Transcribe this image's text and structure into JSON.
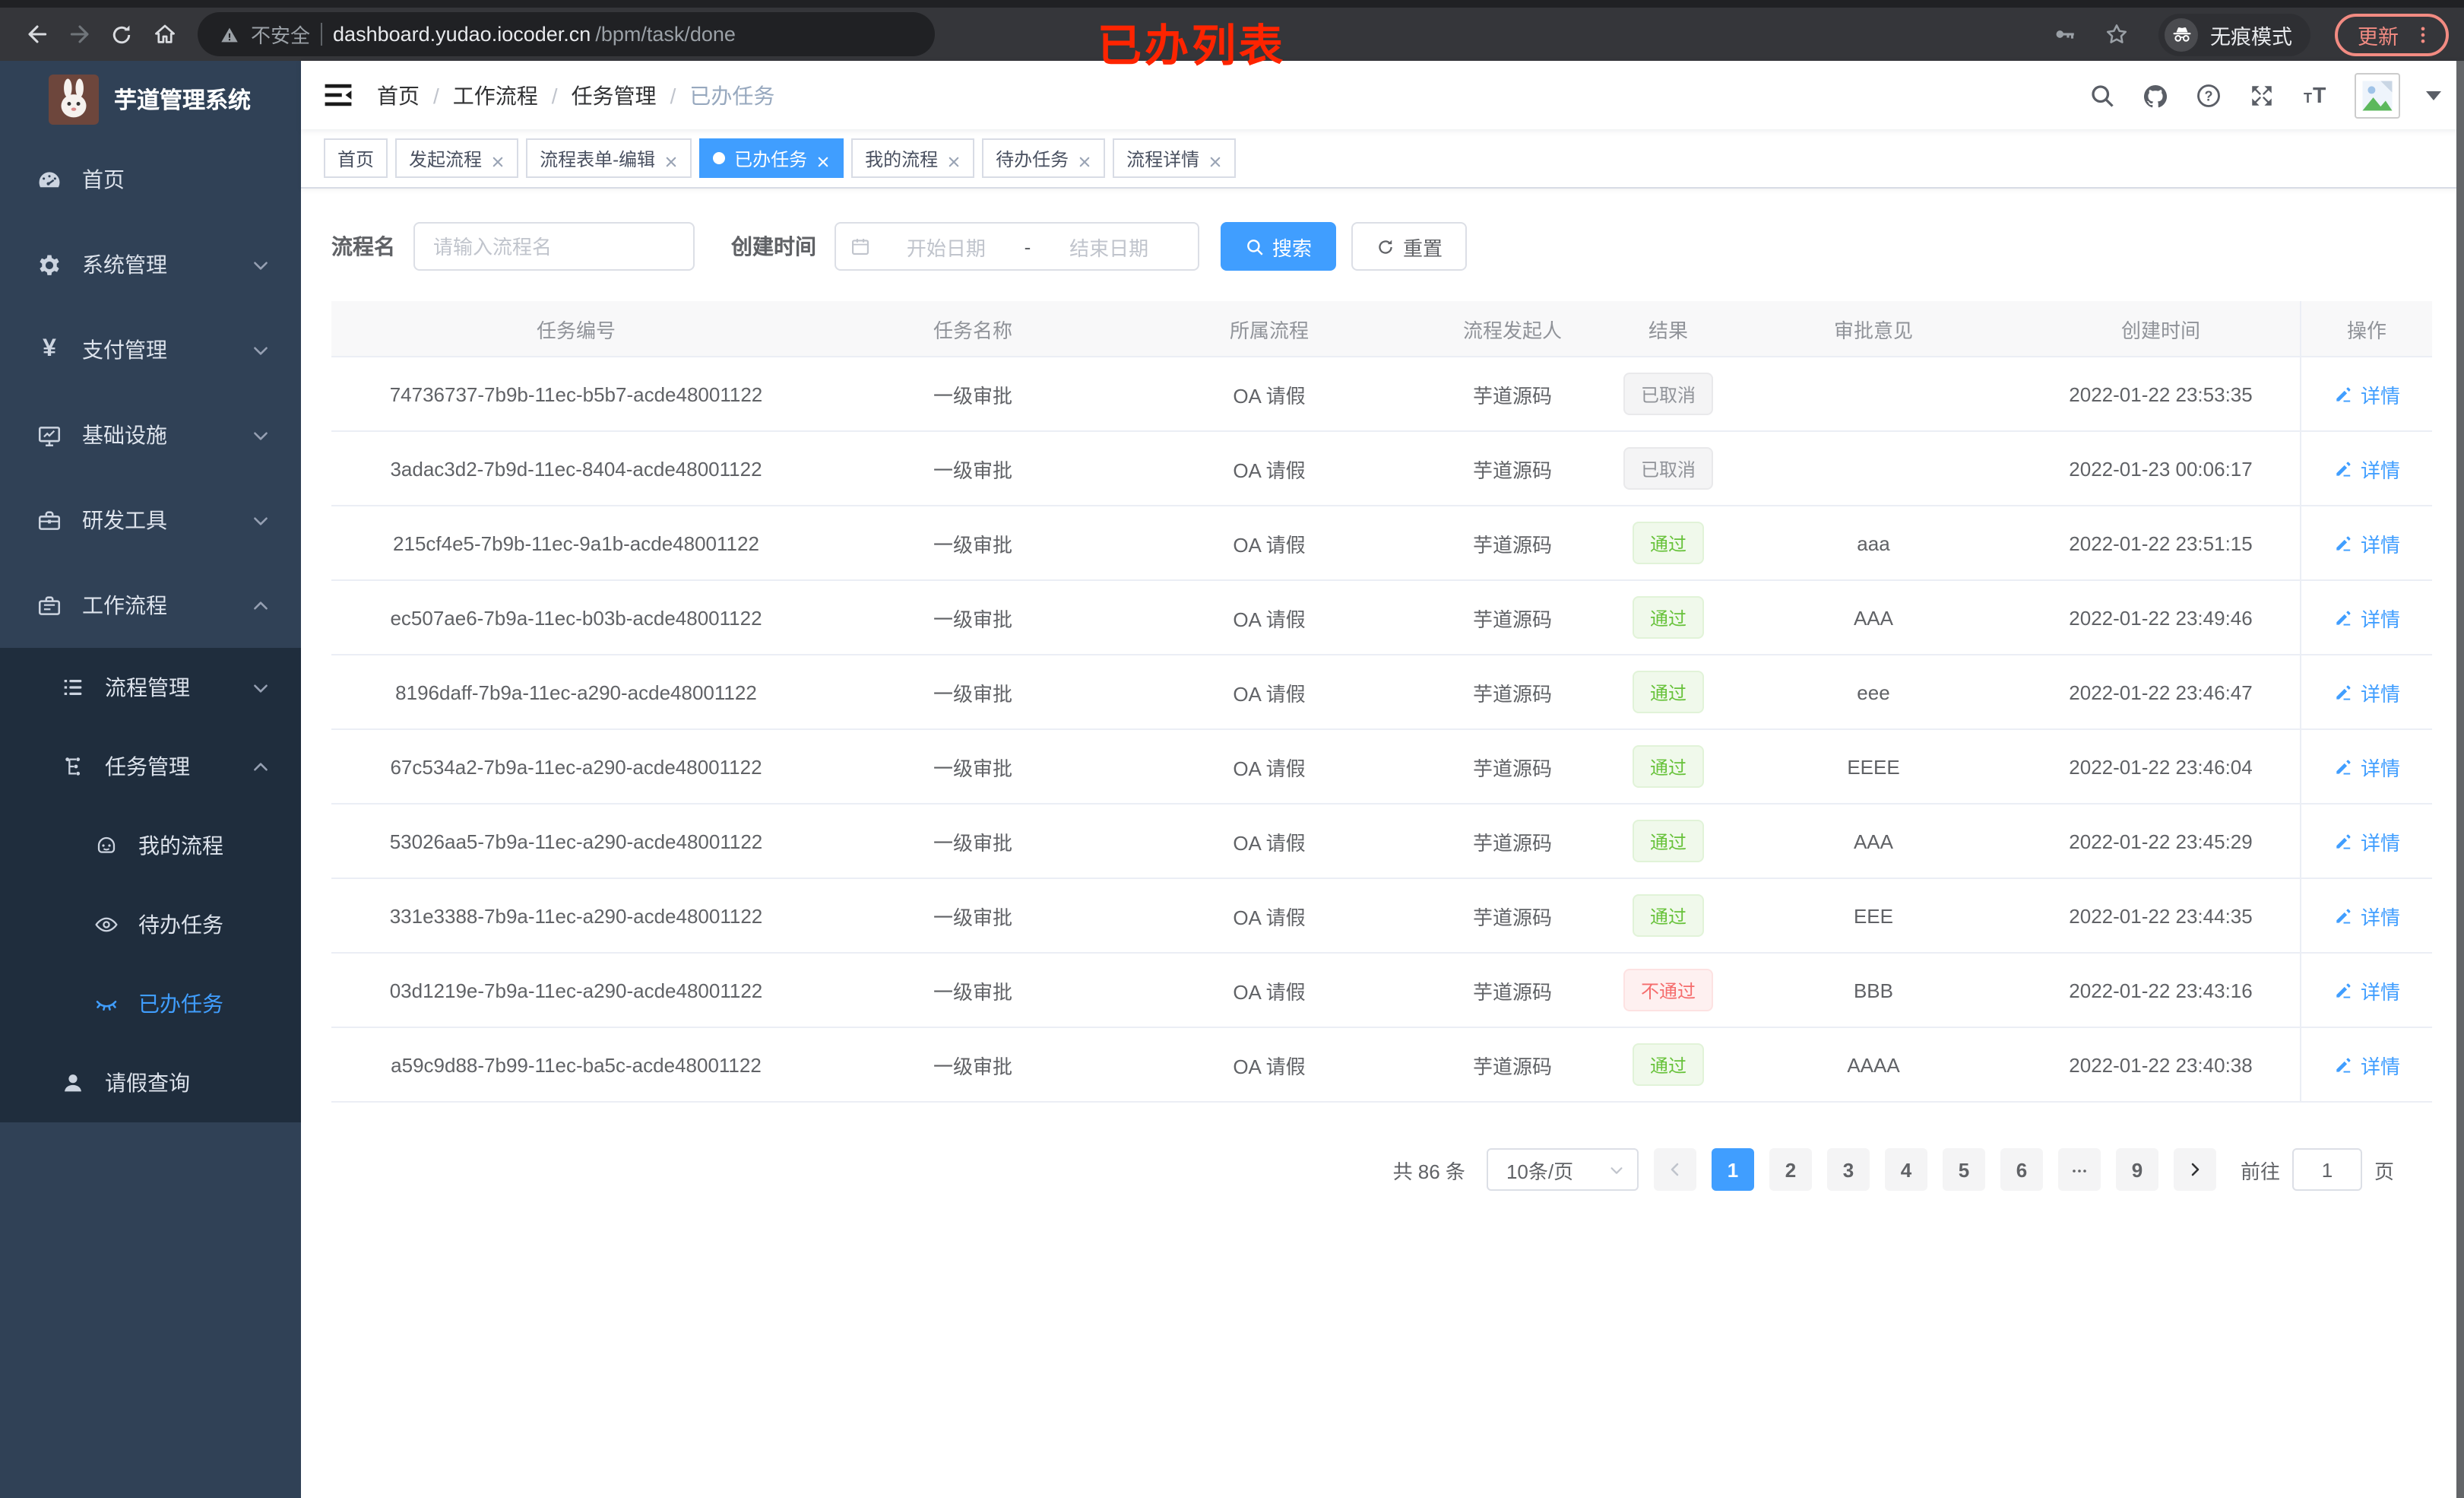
{
  "browser": {
    "security_label": "不安全",
    "url_host": "dashboard.yudao.iocoder.cn",
    "url_path": "/bpm/task/done",
    "incognito_label": "无痕模式",
    "update_label": "更新"
  },
  "annotation": {
    "text": "已办列表"
  },
  "app": {
    "title": "芋道管理系统"
  },
  "sidebar": {
    "items": [
      {
        "label": "首页"
      },
      {
        "label": "系统管理"
      },
      {
        "label": "支付管理"
      },
      {
        "label": "基础设施"
      },
      {
        "label": "研发工具"
      },
      {
        "label": "工作流程"
      }
    ],
    "submenu": [
      {
        "label": "流程管理"
      },
      {
        "label": "任务管理"
      },
      {
        "label": "我的流程"
      },
      {
        "label": "待办任务"
      },
      {
        "label": "已办任务"
      },
      {
        "label": "请假查询"
      }
    ]
  },
  "header": {
    "breadcrumb": [
      {
        "label": "首页"
      },
      {
        "label": "工作流程"
      },
      {
        "label": "任务管理"
      },
      {
        "label": "已办任务"
      }
    ],
    "separator": "/"
  },
  "tabs": [
    {
      "label": "首页"
    },
    {
      "label": "发起流程"
    },
    {
      "label": "流程表单-编辑"
    },
    {
      "label": "已办任务"
    },
    {
      "label": "我的流程"
    },
    {
      "label": "待办任务"
    },
    {
      "label": "流程详情"
    }
  ],
  "filters": {
    "name_label": "流程名",
    "name_placeholder": "请输入流程名",
    "time_label": "创建时间",
    "start_placeholder": "开始日期",
    "range_separator": "-",
    "end_placeholder": "结束日期",
    "search_label": "搜索",
    "reset_label": "重置"
  },
  "table": {
    "columns": [
      "任务编号",
      "任务名称",
      "所属流程",
      "流程发起人",
      "结果",
      "审批意见",
      "创建时间",
      "操作"
    ],
    "action_label": "详情",
    "rows": [
      {
        "task_id": "74736737-7b9b-11ec-b5b7-acde48001122",
        "task_name": "一级审批",
        "process": "OA 请假",
        "initiator": "芋道源码",
        "result": {
          "label": "已取消",
          "type": "info"
        },
        "comment": "",
        "created_at": "2022-01-22 23:53:35"
      },
      {
        "task_id": "3adac3d2-7b9d-11ec-8404-acde48001122",
        "task_name": "一级审批",
        "process": "OA 请假",
        "initiator": "芋道源码",
        "result": {
          "label": "已取消",
          "type": "info"
        },
        "comment": "",
        "created_at": "2022-01-23 00:06:17"
      },
      {
        "task_id": "215cf4e5-7b9b-11ec-9a1b-acde48001122",
        "task_name": "一级审批",
        "process": "OA 请假",
        "initiator": "芋道源码",
        "result": {
          "label": "通过",
          "type": "success"
        },
        "comment": "aaa",
        "created_at": "2022-01-22 23:51:15"
      },
      {
        "task_id": "ec507ae6-7b9a-11ec-b03b-acde48001122",
        "task_name": "一级审批",
        "process": "OA 请假",
        "initiator": "芋道源码",
        "result": {
          "label": "通过",
          "type": "success"
        },
        "comment": "AAA",
        "created_at": "2022-01-22 23:49:46"
      },
      {
        "task_id": "8196daff-7b9a-11ec-a290-acde48001122",
        "task_name": "一级审批",
        "process": "OA 请假",
        "initiator": "芋道源码",
        "result": {
          "label": "通过",
          "type": "success"
        },
        "comment": "eee",
        "created_at": "2022-01-22 23:46:47"
      },
      {
        "task_id": "67c534a2-7b9a-11ec-a290-acde48001122",
        "task_name": "一级审批",
        "process": "OA 请假",
        "initiator": "芋道源码",
        "result": {
          "label": "通过",
          "type": "success"
        },
        "comment": "EEEE",
        "created_at": "2022-01-22 23:46:04"
      },
      {
        "task_id": "53026aa5-7b9a-11ec-a290-acde48001122",
        "task_name": "一级审批",
        "process": "OA 请假",
        "initiator": "芋道源码",
        "result": {
          "label": "通过",
          "type": "success"
        },
        "comment": "AAA",
        "created_at": "2022-01-22 23:45:29"
      },
      {
        "task_id": "331e3388-7b9a-11ec-a290-acde48001122",
        "task_name": "一级审批",
        "process": "OA 请假",
        "initiator": "芋道源码",
        "result": {
          "label": "通过",
          "type": "success"
        },
        "comment": "EEE",
        "created_at": "2022-01-22 23:44:35"
      },
      {
        "task_id": "03d1219e-7b9a-11ec-a290-acde48001122",
        "task_name": "一级审批",
        "process": "OA 请假",
        "initiator": "芋道源码",
        "result": {
          "label": "不通过",
          "type": "danger"
        },
        "comment": "BBB",
        "created_at": "2022-01-22 23:43:16"
      },
      {
        "task_id": "a59c9d88-7b99-11ec-ba5c-acde48001122",
        "task_name": "一级审批",
        "process": "OA 请假",
        "initiator": "芋道源码",
        "result": {
          "label": "通过",
          "type": "success"
        },
        "comment": "AAAA",
        "created_at": "2022-01-22 23:40:38"
      }
    ]
  },
  "pagination": {
    "total": "共 86 条",
    "page_size": "10条/页",
    "pages": [
      "1",
      "2",
      "3",
      "4",
      "5",
      "6",
      "9"
    ],
    "goto_label": "前往",
    "goto_value": "1",
    "unit_label": "页"
  },
  "colors": {
    "accent": "#409eff",
    "success": "#67c23a",
    "danger": "#f56c6c",
    "info": "#909399",
    "sidebar": "#304156",
    "sidebar_sub": "#1f2d3d",
    "annotation_red": "#fe2400"
  },
  "icons": [
    "back-icon",
    "forward-icon",
    "reload-icon",
    "home-icon",
    "warning-icon",
    "key-icon",
    "star-icon",
    "incognito-icon",
    "kebab-menu-icon",
    "search-icon",
    "github-icon",
    "question-icon",
    "fullscreen-icon",
    "font-size-icon",
    "calendar-icon",
    "refresh-icon",
    "edit-pencil-icon",
    "dashboard-icon",
    "gear-icon",
    "yen-icon",
    "monitor-icon",
    "toolbox-icon",
    "briefcase-icon",
    "list-icon",
    "tree-icon",
    "robot-icon",
    "eye-icon",
    "eye-closed-icon",
    "user-icon",
    "chevron-down-icon",
    "chevron-up-icon",
    "close-icon"
  ]
}
